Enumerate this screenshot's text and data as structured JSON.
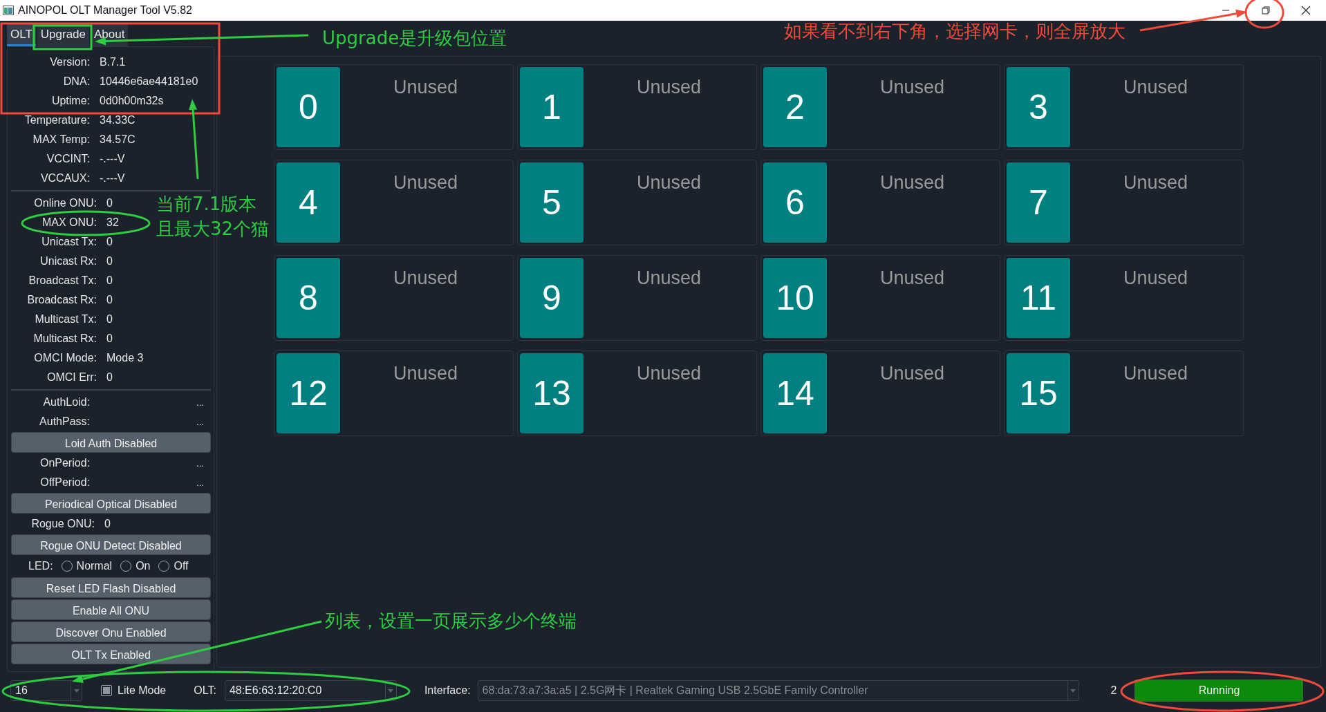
{
  "window": {
    "title": "AINOPOL OLT Manager Tool V5.82"
  },
  "tabs": [
    {
      "label": "OLT",
      "selected": true
    },
    {
      "label": "Upgrade",
      "selected": false
    },
    {
      "label": "About",
      "selected": false
    }
  ],
  "info_groups": [
    [
      {
        "label": "Version:",
        "value": "B.7.1"
      },
      {
        "label": "DNA:",
        "value": "10446e6ae44181e0"
      },
      {
        "label": "Uptime:",
        "value": "0d0h00m32s"
      },
      {
        "label": "Temperature:",
        "value": "34.33C"
      },
      {
        "label": "MAX Temp:",
        "value": "34.57C"
      },
      {
        "label": "VCCINT:",
        "value": "-.---V"
      },
      {
        "label": "VCCAUX:",
        "value": "-.---V"
      }
    ],
    [
      {
        "label": "Online ONU:",
        "value": "0"
      },
      {
        "label": "MAX ONU:",
        "value": "32"
      },
      {
        "label": "Unicast Tx:",
        "value": "0"
      },
      {
        "label": "Unicast Rx:",
        "value": "0"
      },
      {
        "label": "Broadcast Tx:",
        "value": "0"
      },
      {
        "label": "Broadcast Rx:",
        "value": "0"
      },
      {
        "label": "Multicast Tx:",
        "value": "0"
      },
      {
        "label": "Multicast Rx:",
        "value": "0"
      },
      {
        "label": "OMCI Mode:",
        "value": "Mode 3"
      },
      {
        "label": "OMCI Err:",
        "value": "0"
      }
    ]
  ],
  "settings": [
    {
      "kind": "field",
      "label": "AuthLoid:",
      "value": "..."
    },
    {
      "kind": "field",
      "label": "AuthPass:",
      "value": "..."
    },
    {
      "kind": "button",
      "label": "Loid Auth Disabled"
    },
    {
      "kind": "field",
      "label": "OnPeriod:",
      "value": "..."
    },
    {
      "kind": "field",
      "label": "OffPeriod:",
      "value": "..."
    },
    {
      "kind": "button",
      "label": "Periodical Optical Disabled"
    },
    {
      "kind": "stat",
      "label": "Rogue ONU:",
      "value": "0"
    },
    {
      "kind": "button",
      "label": "Rogue ONU Detect Disabled"
    },
    {
      "kind": "radio",
      "label": "LED:",
      "options": [
        {
          "label": "Normal",
          "selected": false
        },
        {
          "label": "On",
          "selected": false
        },
        {
          "label": "Off",
          "selected": false
        }
      ]
    },
    {
      "kind": "button",
      "label": "Reset LED Flash Disabled"
    },
    {
      "kind": "button",
      "label": "Enable All ONU"
    },
    {
      "kind": "button",
      "label": "Discover Onu Enabled"
    },
    {
      "kind": "button",
      "label": "OLT Tx Enabled"
    }
  ],
  "onu_grid": [
    {
      "number": "0",
      "status": "Unused"
    },
    {
      "number": "1",
      "status": "Unused"
    },
    {
      "number": "2",
      "status": "Unused"
    },
    {
      "number": "3",
      "status": "Unused"
    },
    {
      "number": "4",
      "status": "Unused"
    },
    {
      "number": "5",
      "status": "Unused"
    },
    {
      "number": "6",
      "status": "Unused"
    },
    {
      "number": "7",
      "status": "Unused"
    },
    {
      "number": "8",
      "status": "Unused"
    },
    {
      "number": "9",
      "status": "Unused"
    },
    {
      "number": "10",
      "status": "Unused"
    },
    {
      "number": "11",
      "status": "Unused"
    },
    {
      "number": "12",
      "status": "Unused"
    },
    {
      "number": "13",
      "status": "Unused"
    },
    {
      "number": "14",
      "status": "Unused"
    },
    {
      "number": "15",
      "status": "Unused"
    }
  ],
  "status_bar": {
    "page_size": "16",
    "lite_mode": {
      "label": "Lite Mode",
      "checked": true
    },
    "olt": {
      "label": "OLT:",
      "value": "48:E6:63:12:20:C0"
    },
    "interface": {
      "label": "Interface:",
      "value": "68:da:73:a7:3a:a5 | 2.5G网卡 | Realtek Gaming USB 2.5GbE Family Controller",
      "disabled": true
    },
    "count": "2",
    "status_button": "Running"
  },
  "annotations": [
    {
      "text": "Upgrade是升级包位置",
      "color": "#2ecc40"
    },
    {
      "text": "如果看不到右下角，选择网卡，则全屏放大",
      "color": "#f04a3a"
    },
    {
      "text": "当前7.1版本",
      "color": "#2ecc40"
    },
    {
      "text": "且最大32个猫",
      "color": "#2ecc40"
    },
    {
      "text": "列表，设置一页展示多少个终端",
      "color": "#2ecc40"
    }
  ]
}
